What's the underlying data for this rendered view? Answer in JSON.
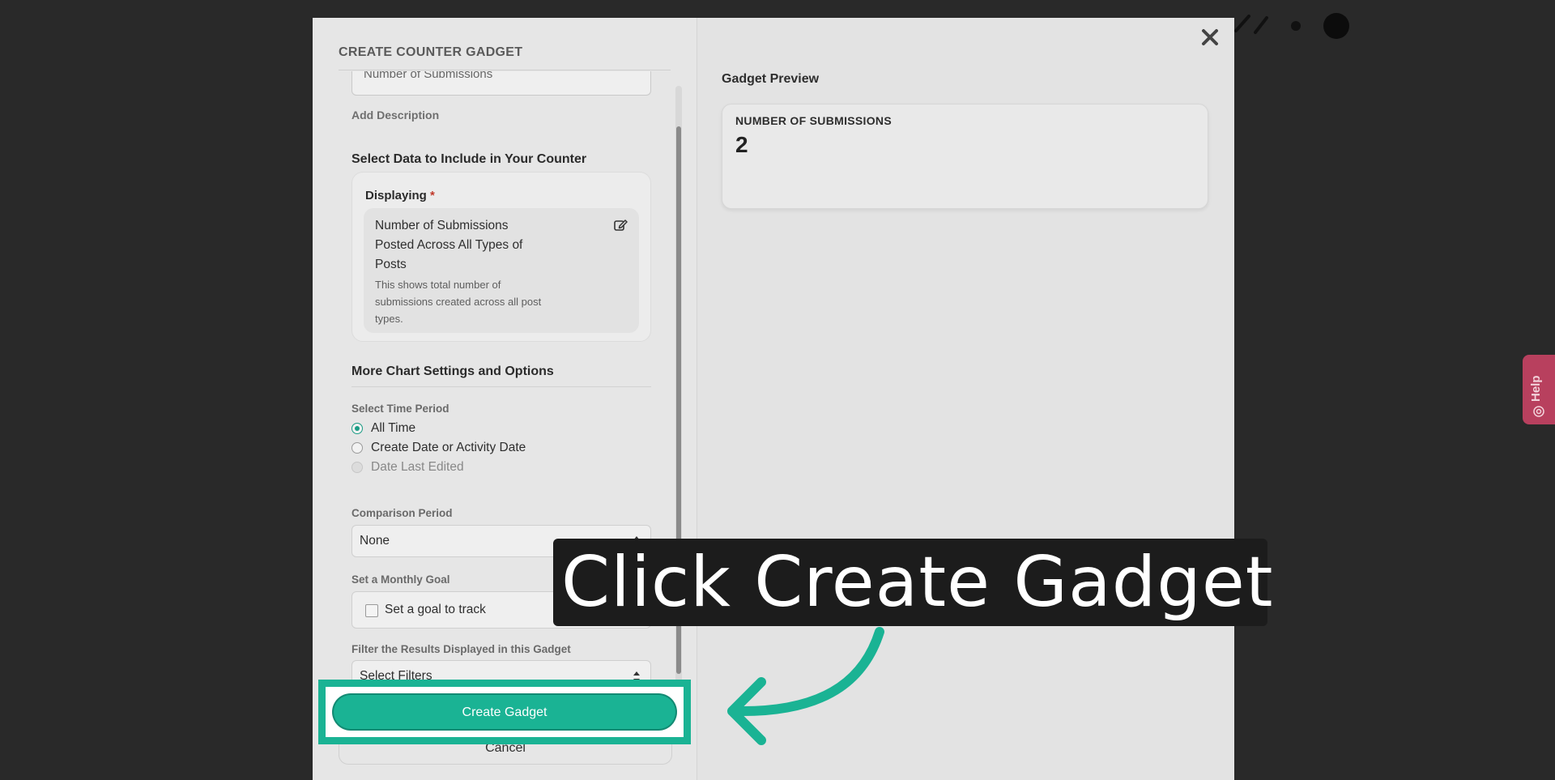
{
  "modal": {
    "title": "CREATE COUNTER GADGET",
    "name_field_value": "Number of Submissions",
    "add_description": "Add Description",
    "select_data_heading": "Select Data to Include in Your Counter",
    "displaying_label": "Displaying",
    "required_mark": "*",
    "metric_title": "Number of Submissions Posted Across All Types of Posts",
    "metric_description": "This shows total number of submissions created across all post types.",
    "more_settings_heading": "More Chart Settings and Options",
    "time_period_label": "Select Time Period",
    "time_period_options": [
      {
        "label": "All Time",
        "checked": true,
        "disabled": false
      },
      {
        "label": "Create Date or Activity Date",
        "checked": false,
        "disabled": false
      },
      {
        "label": "Date Last Edited",
        "checked": false,
        "disabled": true
      }
    ],
    "comparison_label": "Comparison Period",
    "comparison_value": "None",
    "goal_label": "Set a Monthly Goal",
    "goal_checkbox_label": "Set a goal to track",
    "filter_label": "Filter the Results Displayed in this Gadget",
    "filter_value": "Select Filters",
    "create_button": "Create Gadget",
    "cancel_button": "Cancel"
  },
  "preview": {
    "label": "Gadget Preview",
    "metric_title": "NUMBER OF SUBMISSIONS",
    "metric_value": "2"
  },
  "help_tab": {
    "label": "Help"
  },
  "callout": {
    "text": "Click Create Gadget"
  },
  "colors": {
    "accent": "#1ab394",
    "help_tab": "#b8405e",
    "callout_bg": "#1c1c1c"
  }
}
